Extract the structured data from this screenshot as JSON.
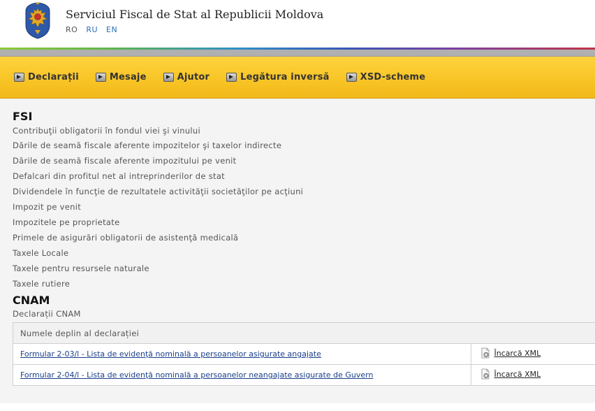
{
  "header": {
    "title": "Serviciul Fiscal de Stat al Republicii Moldova",
    "emblem_icon": "moldova-coat-of-arms",
    "languages": [
      {
        "code": "RO",
        "active": true
      },
      {
        "code": "RU",
        "active": false
      },
      {
        "code": "EN",
        "active": false
      }
    ]
  },
  "menu": {
    "items": [
      {
        "label": "Declarații",
        "icon": "arrow-right-icon"
      },
      {
        "label": "Mesaje",
        "icon": "arrow-right-icon"
      },
      {
        "label": "Ajutor",
        "icon": "arrow-right-icon"
      },
      {
        "label": "Legătura inversă",
        "icon": "arrow-right-icon"
      },
      {
        "label": "XSD-scheme",
        "icon": "arrow-right-icon"
      }
    ]
  },
  "fsi": {
    "title": "FSI",
    "categories": [
      "Contribuţii obligatorii în fondul viei şi vinului",
      "Dările de seamă fiscale aferente impozitelor şi taxelor indirecte",
      "Dările de seamă fiscale aferente impozitului pe venit",
      "Defalcari din profitul net al intreprinderilor de stat",
      "Dividendele în funcţie de rezultatele activităţii societăţilor pe acţiuni",
      "Impozit pe venit",
      "Impozitele pe proprietate",
      "Primele de asigurări obligatorii de asistenţă medicală",
      "Taxele Locale",
      "Taxele pentru resursele naturale",
      "Taxele rutiere"
    ]
  },
  "cnam": {
    "title": "CNAM",
    "subtitle": "Declarații CNAM",
    "table": {
      "header": "Numele deplin al declarației",
      "rows": [
        {
          "name": "Formular 2-03/l - Lista de evidenţă nominală a persoanelor asigurate angajate",
          "action": "Încarcă XML"
        },
        {
          "name": "Formular 2-04/l - Lista de evidenţă nominală a persoanelor neangajate asigurate de Guvern",
          "action": "Încarcă XML"
        }
      ]
    }
  },
  "colors": {
    "menu_bar": "#f8c526",
    "link": "#1a3f8a",
    "lang_link": "#2a6ebb",
    "content_bg": "#f4f4f4"
  }
}
